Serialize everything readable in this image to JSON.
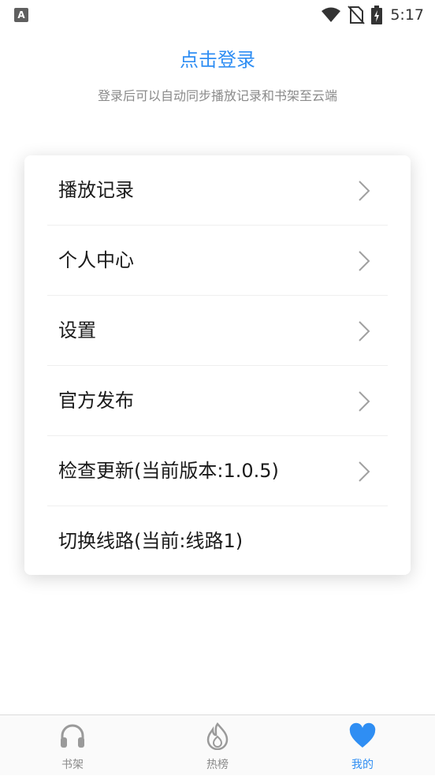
{
  "status_bar": {
    "app_icon": "A",
    "time": "5:17",
    "icons": [
      "wifi-icon",
      "no-sim-icon",
      "battery-charging-icon"
    ]
  },
  "login": {
    "title": "点击登录",
    "subtitle": "登录后可以自动同步播放记录和书架至云端"
  },
  "menu": {
    "items": [
      {
        "label": "播放记录",
        "icon": "chevron-right-icon"
      },
      {
        "label": "个人中心",
        "icon": "chevron-right-icon"
      },
      {
        "label": "设置",
        "icon": "chevron-right-icon"
      },
      {
        "label": "官方发布",
        "icon": "chevron-right-icon"
      },
      {
        "label": "检查更新(当前版本:1.0.5)",
        "icon": "chevron-right-icon"
      },
      {
        "label": "切换线路(当前:线路1)"
      }
    ]
  },
  "bottom_nav": {
    "tabs": [
      {
        "label": "书架",
        "icon": "headphones-icon",
        "active": false
      },
      {
        "label": "热榜",
        "icon": "flame-icon",
        "active": false
      },
      {
        "label": "我的",
        "icon": "heart-icon",
        "active": true
      }
    ]
  },
  "colors": {
    "accent": "#2f8ef3",
    "text_primary": "#1a1a1a",
    "text_secondary": "#8a8a8a",
    "inactive_icon": "#9a9a9a"
  }
}
